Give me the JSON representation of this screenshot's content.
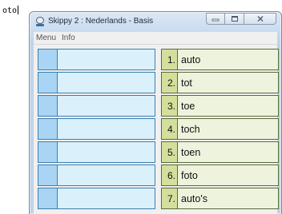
{
  "typed_text": "oto",
  "window": {
    "title": "Skippy 2 : Nederlands - Basis",
    "menu": [
      "Menu",
      "Info"
    ]
  },
  "input_rows": 7,
  "suggestions": [
    {
      "number": "1.",
      "word": "auto"
    },
    {
      "number": "2.",
      "word": "tot"
    },
    {
      "number": "3.",
      "word": "toe"
    },
    {
      "number": "4.",
      "word": "toch"
    },
    {
      "number": "5.",
      "word": "toen"
    },
    {
      "number": "6.",
      "word": "foto"
    },
    {
      "number": "7.",
      "word": "auto's"
    }
  ],
  "colors": {
    "input_square": "#a9d4f3",
    "input_field": "#daf0fb",
    "number_cell": "#d3df9b",
    "word_cell": "#eef3dd"
  }
}
